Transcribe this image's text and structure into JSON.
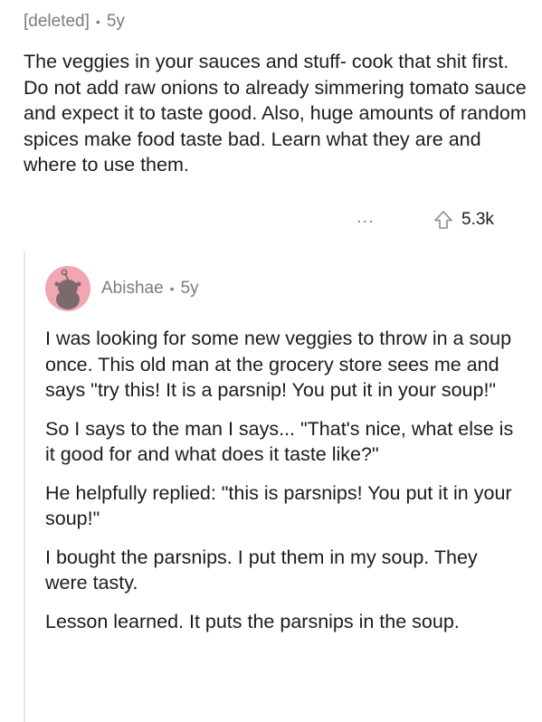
{
  "parent_comment": {
    "author": "[deleted]",
    "age": "5y",
    "text": "The veggies in your sauces and stuff- cook that shit first. Do not add raw onions to already simmering tomato sauce and expect it to taste good. Also, huge amounts of random spices make food taste bad. Learn what they are and where to use them.",
    "more_label": "...",
    "upvote_count": "5.3k",
    "icons": {
      "more": "more-options-icon",
      "upvote": "upvote-arrow-icon"
    }
  },
  "reply": {
    "author": "Abishae",
    "age": "5y",
    "avatar_icon": "snoo-avatar-icon",
    "avatar_color": "#f2a6b0",
    "paragraphs": [
      "I was looking for some new veggies to throw in a soup once. This old man at the grocery store sees me and says \"try this! It is a parsnip! You put it in your soup!\"",
      "So I says to the man I says... \"That's nice, what else is it good for and what does it taste like?\"",
      "He helpfully replied: \"this is parsnips! You put it in your soup!\"",
      "I bought the parsnips. I put them in my soup. They were tasty.",
      "Lesson learned. It puts the parsnips in the soup."
    ]
  },
  "separator": "•"
}
